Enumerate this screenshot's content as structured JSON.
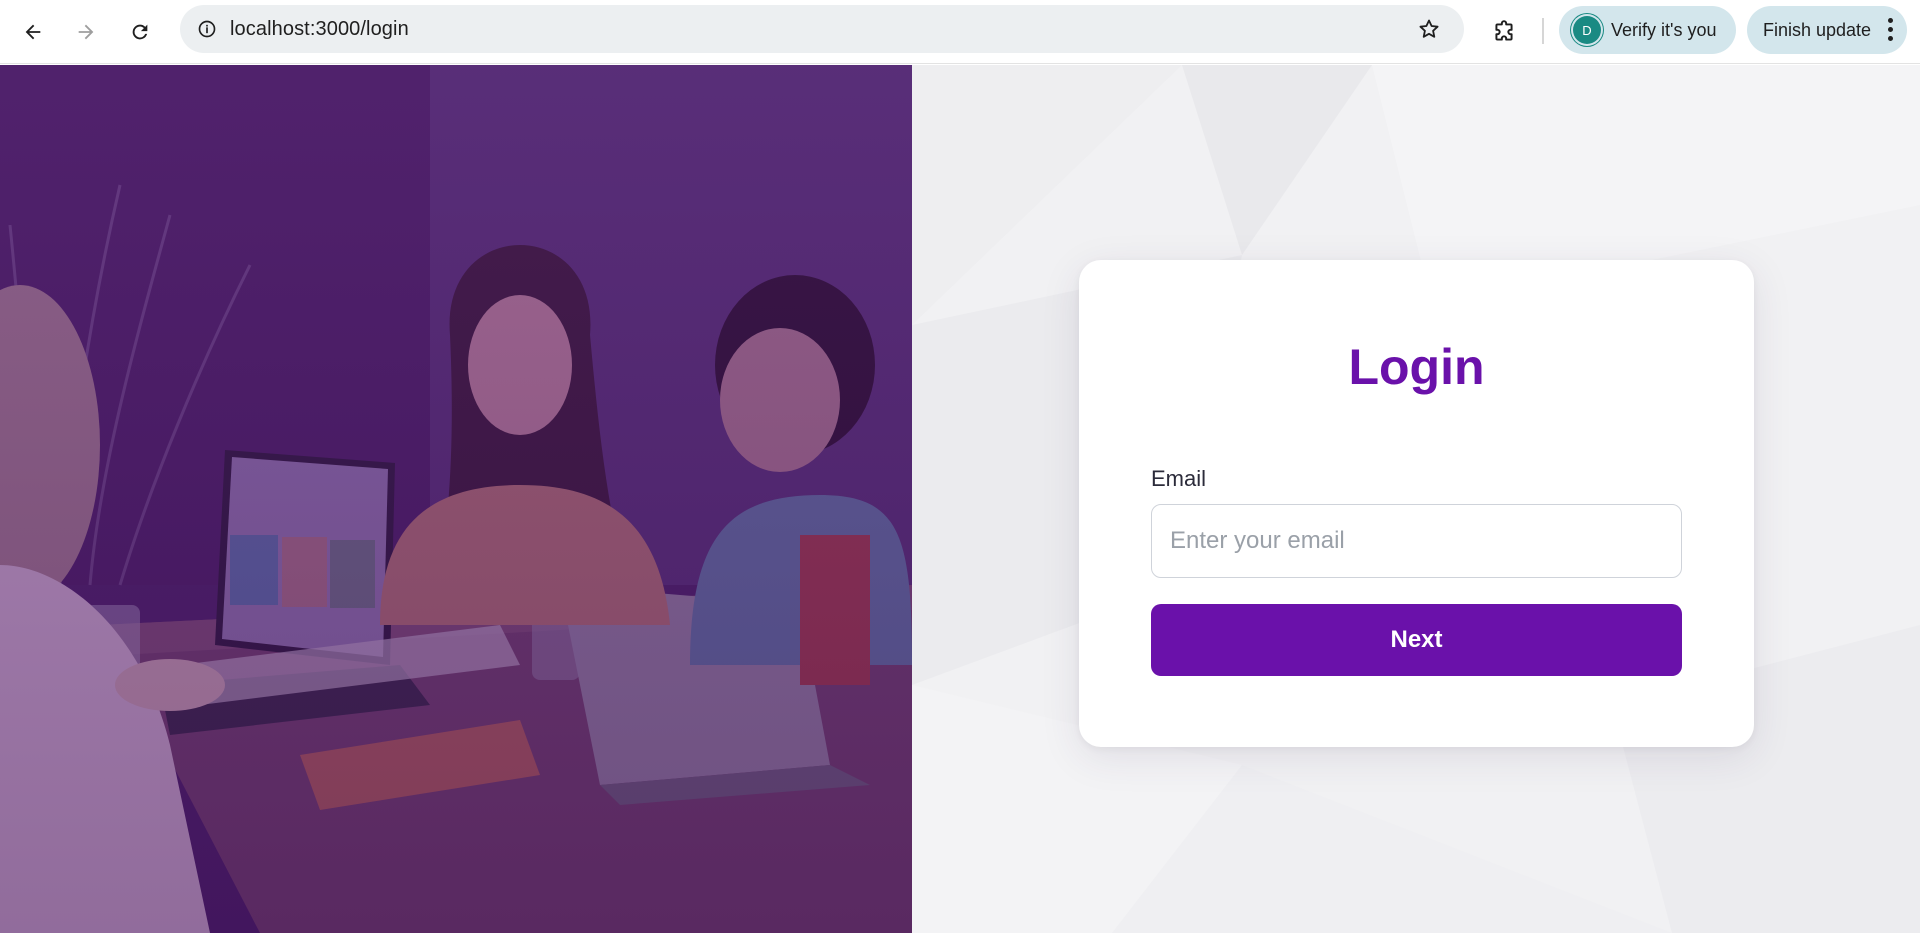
{
  "browser": {
    "url": "localhost:3000/login",
    "verify_label": "Verify it's you",
    "avatar_letter": "D",
    "update_label": "Finish update"
  },
  "login": {
    "title": "Login",
    "email_label": "Email",
    "email_placeholder": "Enter your email",
    "email_value": "",
    "next_label": "Next"
  },
  "colors": {
    "accent": "#6a11aa",
    "hero_tint": "#4a1d66",
    "panel_bg": "#f0f0f2"
  }
}
